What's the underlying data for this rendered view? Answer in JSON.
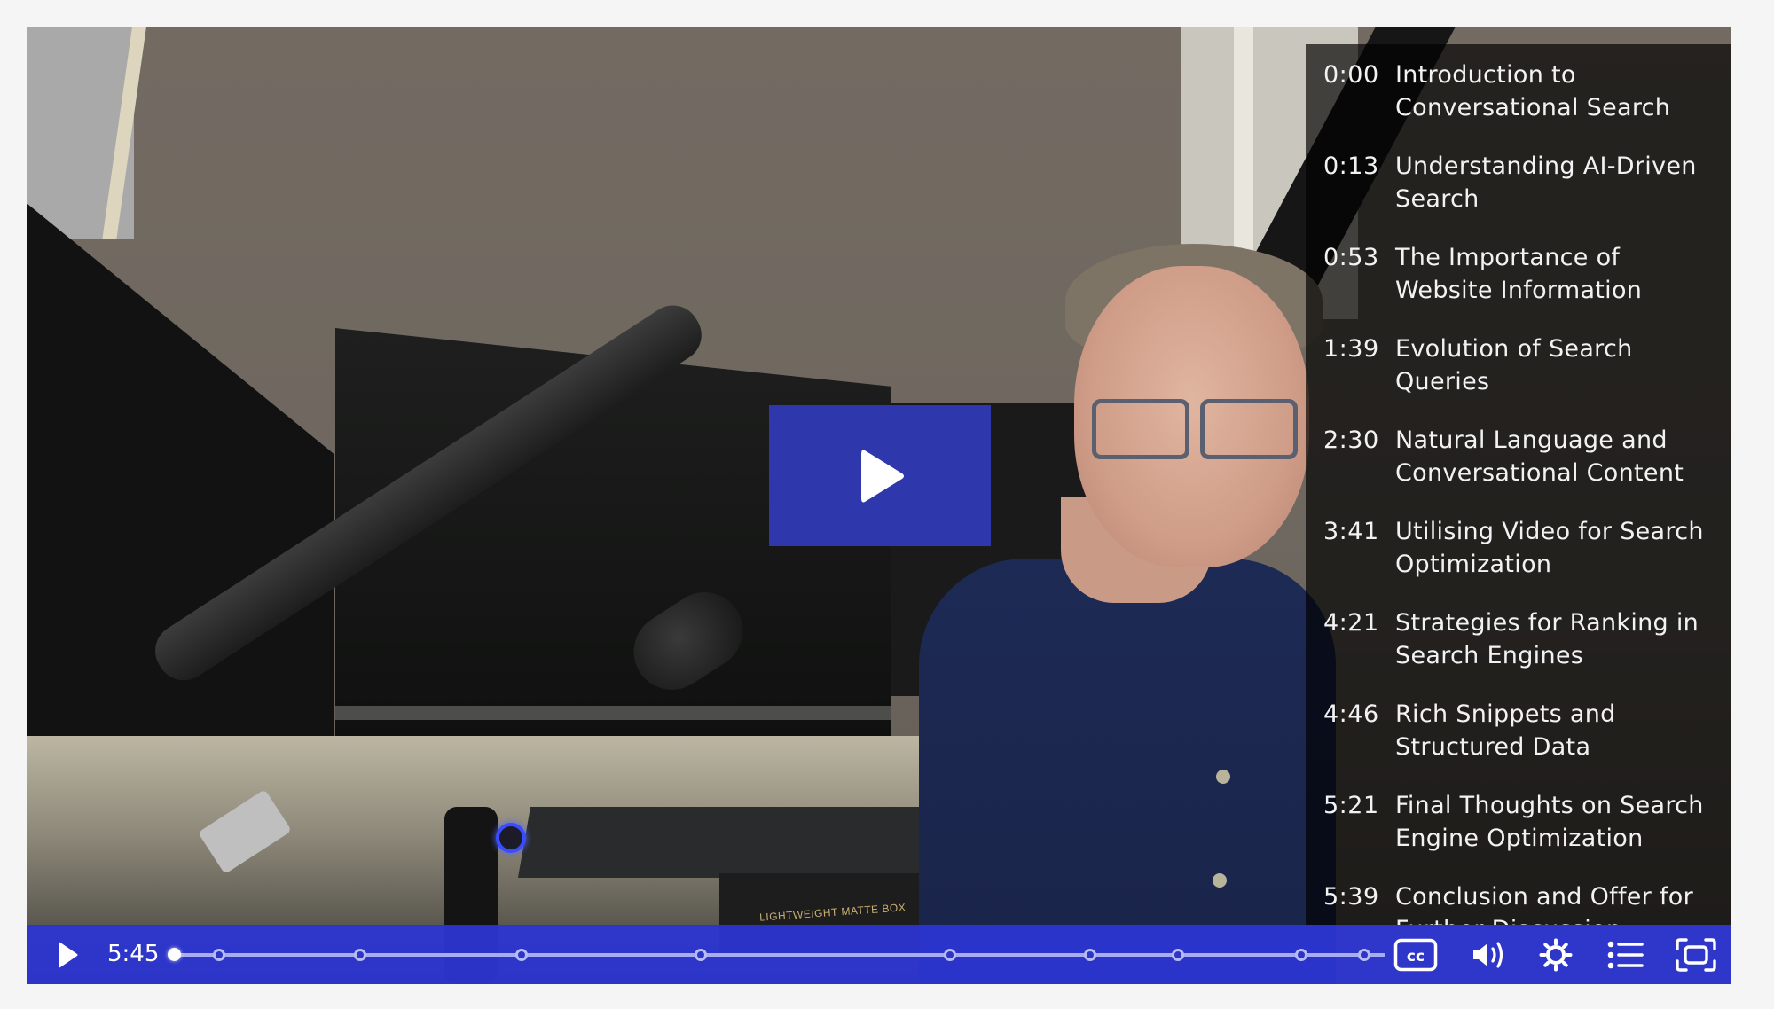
{
  "player": {
    "accent_color": "#2e37ac",
    "controlbar_color": "#2d35d2",
    "big_play_icon": "play-icon",
    "time_display": "5:45",
    "duration_seconds": 345,
    "current_seconds": 0,
    "controls": {
      "play_icon": "play-icon",
      "captions_icon": "closed-captions-icon",
      "volume_icon": "volume-icon",
      "settings_icon": "gear-icon",
      "chapters_icon": "list-icon",
      "fullscreen_icon": "fullscreen-icon"
    }
  },
  "scene": {
    "product_label": "LIGHTWEIGHT MATTE BOX"
  },
  "chapters": [
    {
      "time": "0:00",
      "seconds": 0,
      "title": "Introduction to Conversational Search"
    },
    {
      "time": "0:13",
      "seconds": 13,
      "title": "Understanding AI-Driven Search"
    },
    {
      "time": "0:53",
      "seconds": 53,
      "title": "The Importance of Website Information"
    },
    {
      "time": "1:39",
      "seconds": 99,
      "title": "Evolution of Search Queries"
    },
    {
      "time": "2:30",
      "seconds": 150,
      "title": "Natural Language and Conversational Content"
    },
    {
      "time": "3:41",
      "seconds": 221,
      "title": "Utilising Video for Search Optimization"
    },
    {
      "time": "4:21",
      "seconds": 261,
      "title": "Strategies for Ranking in Search Engines"
    },
    {
      "time": "4:46",
      "seconds": 286,
      "title": "Rich Snippets and Structured Data"
    },
    {
      "time": "5:21",
      "seconds": 321,
      "title": "Final Thoughts on Search Engine Optimization"
    },
    {
      "time": "5:39",
      "seconds": 339,
      "title": "Conclusion and Offer for Further Discussion"
    }
  ]
}
